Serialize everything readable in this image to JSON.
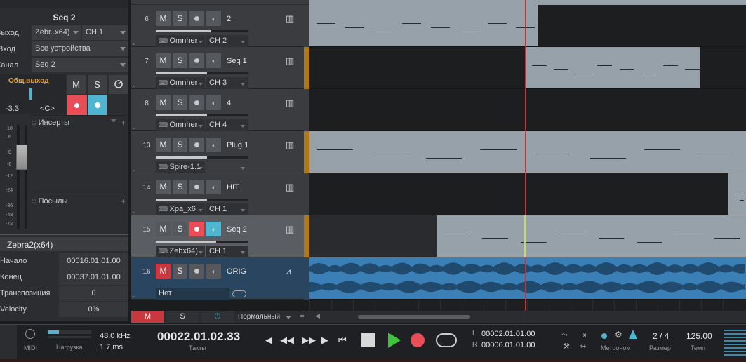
{
  "inspector": {
    "title": "Seq 2",
    "output_label": "Выход",
    "output_value": "Zebr..x64)",
    "output_ch": "CH 1",
    "input_label": "Вход",
    "input_value": "Все устройства",
    "channel_label": "Канал",
    "channel_value": "Seq 2",
    "bus_label": "Общ.выход",
    "volume": "-3.3",
    "pan": "<C>",
    "mute": "M",
    "solo": "S",
    "meter_ticks": [
      "10",
      "6",
      "0",
      "-6",
      "-12",
      "-24",
      "-36",
      "-48",
      "-72"
    ],
    "inserts": "Инсерты",
    "sends": "Посылы",
    "instrument": "Zebra2(x64)",
    "rows": [
      {
        "k": "Начало",
        "v": "00016.01.01.00"
      },
      {
        "k": "Конец",
        "v": "00037.01.01.00"
      },
      {
        "k": "Транспозиция",
        "v": "0"
      },
      {
        "k": "Velocity",
        "v": "0%"
      }
    ]
  },
  "tracks": [
    {
      "num": "6",
      "name": "2",
      "input": "Omnher",
      "ch": "CH 2",
      "slider": 0.6,
      "type": "instr"
    },
    {
      "num": "7",
      "name": "Seq 1",
      "input": "Omnher",
      "ch": "CH 3",
      "slider": 0.55,
      "type": "instr"
    },
    {
      "num": "8",
      "name": "4",
      "input": "Omnher",
      "ch": "CH 4",
      "slider": 0.55,
      "type": "instr"
    },
    {
      "num": "13",
      "name": "Plug 1",
      "input": "Spire-1.1",
      "ch": "",
      "slider": 0.55,
      "type": "instr"
    },
    {
      "num": "14",
      "name": "HIT",
      "input": "Xpa_x6",
      "ch": "CH 1",
      "slider": 0.55,
      "type": "instr"
    },
    {
      "num": "15",
      "name": "Seq 2",
      "input": "Zebx64)",
      "ch": "CH 1",
      "slider": 0.65,
      "type": "selected"
    },
    {
      "num": "16",
      "name": "ORIG",
      "input": "Нет",
      "ch": "",
      "slider": 0,
      "type": "audio"
    }
  ],
  "track_buttons": {
    "m": "M",
    "s": "S"
  },
  "bottom": {
    "m": "M",
    "s": "S",
    "mode": "Нормальный"
  },
  "transport": {
    "midi": "MIDI",
    "load": "Нагрузка",
    "rate": "48.0 kHz",
    "latency": "1.7 ms",
    "time": "00022.01.02.33",
    "time_label": "Такты",
    "l_label": "L",
    "l_value": "00002.01.01.00",
    "r_label": "R",
    "r_value": "00006.01.01.00",
    "metronome": "Метроном",
    "signature": "2 / 4",
    "signature_label": "Размер",
    "tempo": "125.00",
    "tempo_label": "Темп"
  },
  "colors": {
    "accent_orange": "#f0a020",
    "record_red": "#e94e58",
    "cyan": "#4fb5d1",
    "play_green": "#3ec43a",
    "playhead": "#d03030"
  }
}
